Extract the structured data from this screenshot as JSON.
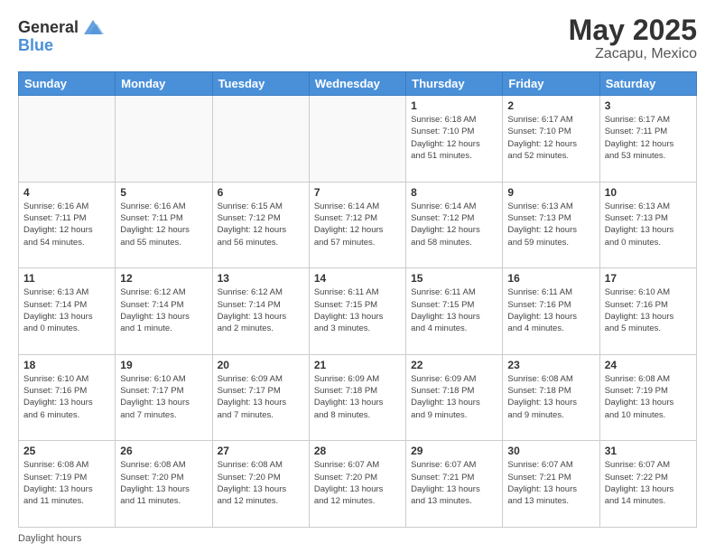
{
  "logo": {
    "general": "General",
    "blue": "Blue"
  },
  "header": {
    "month_year": "May 2025",
    "location": "Zacapu, Mexico"
  },
  "days_of_week": [
    "Sunday",
    "Monday",
    "Tuesday",
    "Wednesday",
    "Thursday",
    "Friday",
    "Saturday"
  ],
  "footer": {
    "note": "Daylight hours"
  },
  "weeks": [
    [
      {
        "day": "",
        "info": ""
      },
      {
        "day": "",
        "info": ""
      },
      {
        "day": "",
        "info": ""
      },
      {
        "day": "",
        "info": ""
      },
      {
        "day": "1",
        "info": "Sunrise: 6:18 AM\nSunset: 7:10 PM\nDaylight: 12 hours\nand 51 minutes."
      },
      {
        "day": "2",
        "info": "Sunrise: 6:17 AM\nSunset: 7:10 PM\nDaylight: 12 hours\nand 52 minutes."
      },
      {
        "day": "3",
        "info": "Sunrise: 6:17 AM\nSunset: 7:11 PM\nDaylight: 12 hours\nand 53 minutes."
      }
    ],
    [
      {
        "day": "4",
        "info": "Sunrise: 6:16 AM\nSunset: 7:11 PM\nDaylight: 12 hours\nand 54 minutes."
      },
      {
        "day": "5",
        "info": "Sunrise: 6:16 AM\nSunset: 7:11 PM\nDaylight: 12 hours\nand 55 minutes."
      },
      {
        "day": "6",
        "info": "Sunrise: 6:15 AM\nSunset: 7:12 PM\nDaylight: 12 hours\nand 56 minutes."
      },
      {
        "day": "7",
        "info": "Sunrise: 6:14 AM\nSunset: 7:12 PM\nDaylight: 12 hours\nand 57 minutes."
      },
      {
        "day": "8",
        "info": "Sunrise: 6:14 AM\nSunset: 7:12 PM\nDaylight: 12 hours\nand 58 minutes."
      },
      {
        "day": "9",
        "info": "Sunrise: 6:13 AM\nSunset: 7:13 PM\nDaylight: 12 hours\nand 59 minutes."
      },
      {
        "day": "10",
        "info": "Sunrise: 6:13 AM\nSunset: 7:13 PM\nDaylight: 13 hours\nand 0 minutes."
      }
    ],
    [
      {
        "day": "11",
        "info": "Sunrise: 6:13 AM\nSunset: 7:14 PM\nDaylight: 13 hours\nand 0 minutes."
      },
      {
        "day": "12",
        "info": "Sunrise: 6:12 AM\nSunset: 7:14 PM\nDaylight: 13 hours\nand 1 minute."
      },
      {
        "day": "13",
        "info": "Sunrise: 6:12 AM\nSunset: 7:14 PM\nDaylight: 13 hours\nand 2 minutes."
      },
      {
        "day": "14",
        "info": "Sunrise: 6:11 AM\nSunset: 7:15 PM\nDaylight: 13 hours\nand 3 minutes."
      },
      {
        "day": "15",
        "info": "Sunrise: 6:11 AM\nSunset: 7:15 PM\nDaylight: 13 hours\nand 4 minutes."
      },
      {
        "day": "16",
        "info": "Sunrise: 6:11 AM\nSunset: 7:16 PM\nDaylight: 13 hours\nand 4 minutes."
      },
      {
        "day": "17",
        "info": "Sunrise: 6:10 AM\nSunset: 7:16 PM\nDaylight: 13 hours\nand 5 minutes."
      }
    ],
    [
      {
        "day": "18",
        "info": "Sunrise: 6:10 AM\nSunset: 7:16 PM\nDaylight: 13 hours\nand 6 minutes."
      },
      {
        "day": "19",
        "info": "Sunrise: 6:10 AM\nSunset: 7:17 PM\nDaylight: 13 hours\nand 7 minutes."
      },
      {
        "day": "20",
        "info": "Sunrise: 6:09 AM\nSunset: 7:17 PM\nDaylight: 13 hours\nand 7 minutes."
      },
      {
        "day": "21",
        "info": "Sunrise: 6:09 AM\nSunset: 7:18 PM\nDaylight: 13 hours\nand 8 minutes."
      },
      {
        "day": "22",
        "info": "Sunrise: 6:09 AM\nSunset: 7:18 PM\nDaylight: 13 hours\nand 9 minutes."
      },
      {
        "day": "23",
        "info": "Sunrise: 6:08 AM\nSunset: 7:18 PM\nDaylight: 13 hours\nand 9 minutes."
      },
      {
        "day": "24",
        "info": "Sunrise: 6:08 AM\nSunset: 7:19 PM\nDaylight: 13 hours\nand 10 minutes."
      }
    ],
    [
      {
        "day": "25",
        "info": "Sunrise: 6:08 AM\nSunset: 7:19 PM\nDaylight: 13 hours\nand 11 minutes."
      },
      {
        "day": "26",
        "info": "Sunrise: 6:08 AM\nSunset: 7:20 PM\nDaylight: 13 hours\nand 11 minutes."
      },
      {
        "day": "27",
        "info": "Sunrise: 6:08 AM\nSunset: 7:20 PM\nDaylight: 13 hours\nand 12 minutes."
      },
      {
        "day": "28",
        "info": "Sunrise: 6:07 AM\nSunset: 7:20 PM\nDaylight: 13 hours\nand 12 minutes."
      },
      {
        "day": "29",
        "info": "Sunrise: 6:07 AM\nSunset: 7:21 PM\nDaylight: 13 hours\nand 13 minutes."
      },
      {
        "day": "30",
        "info": "Sunrise: 6:07 AM\nSunset: 7:21 PM\nDaylight: 13 hours\nand 13 minutes."
      },
      {
        "day": "31",
        "info": "Sunrise: 6:07 AM\nSunset: 7:22 PM\nDaylight: 13 hours\nand 14 minutes."
      }
    ]
  ]
}
